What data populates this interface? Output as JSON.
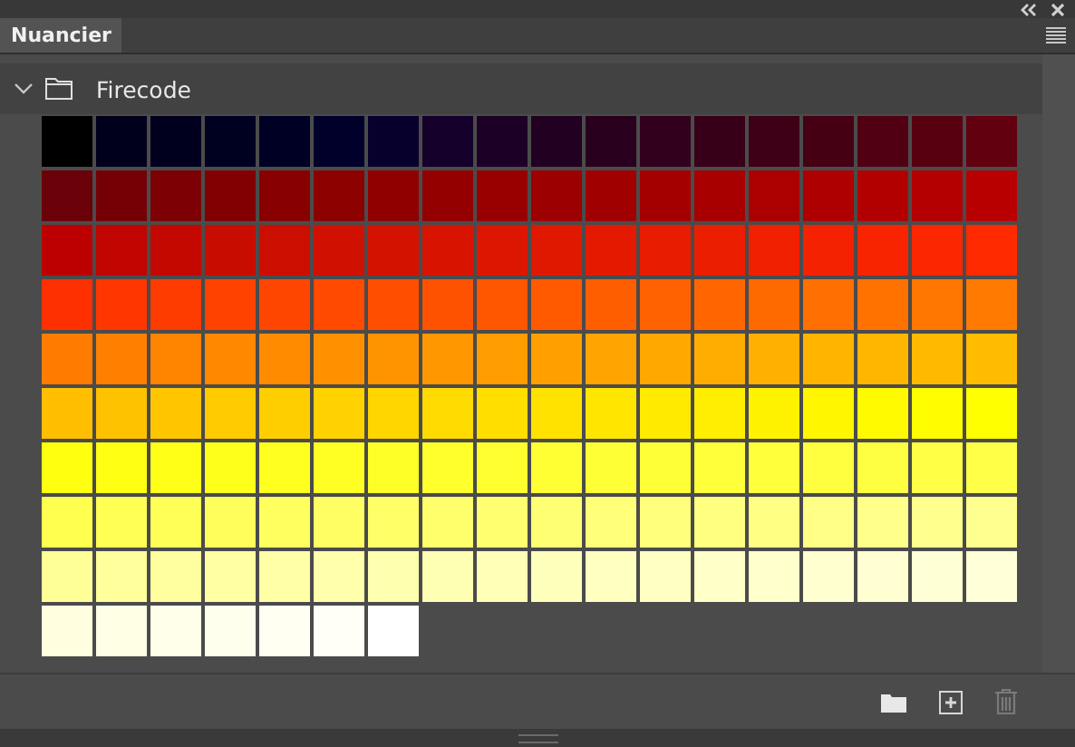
{
  "panel": {
    "tab": {
      "label": "Nuancier",
      "selected": true
    }
  },
  "groups": [
    {
      "name": "Firecode",
      "expanded": true,
      "swatches": [
        {
          "color": "#000000"
        },
        {
          "color": "#00001c"
        },
        {
          "color": "#00001e"
        },
        {
          "color": "#000020"
        },
        {
          "color": "#000024"
        },
        {
          "color": "#00002a"
        },
        {
          "color": "#08002c"
        },
        {
          "color": "#14002a"
        },
        {
          "color": "#1c0026"
        },
        {
          "color": "#220022"
        },
        {
          "color": "#28001e"
        },
        {
          "color": "#30001c"
        },
        {
          "color": "#380018"
        },
        {
          "color": "#3e0016"
        },
        {
          "color": "#460014"
        },
        {
          "color": "#500012"
        },
        {
          "color": "#580010"
        },
        {
          "color": "#620010"
        },
        {
          "color": "#6a0008"
        },
        {
          "color": "#740006"
        },
        {
          "color": "#7c0004"
        },
        {
          "color": "#820002"
        },
        {
          "color": "#880000"
        },
        {
          "color": "#8c0000"
        },
        {
          "color": "#900000"
        },
        {
          "color": "#940000"
        },
        {
          "color": "#980000"
        },
        {
          "color": "#9c0000"
        },
        {
          "color": "#a00000"
        },
        {
          "color": "#a40000"
        },
        {
          "color": "#a80000"
        },
        {
          "color": "#aa0000"
        },
        {
          "color": "#ae0000"
        },
        {
          "color": "#b20000"
        },
        {
          "color": "#b40000"
        },
        {
          "color": "#b80000"
        },
        {
          "color": "#bc0000"
        },
        {
          "color": "#c00400"
        },
        {
          "color": "#c40800"
        },
        {
          "color": "#c80c00"
        },
        {
          "color": "#cc0e00"
        },
        {
          "color": "#d01000"
        },
        {
          "color": "#d41200"
        },
        {
          "color": "#d81400"
        },
        {
          "color": "#dc1600"
        },
        {
          "color": "#e01800"
        },
        {
          "color": "#e41a00"
        },
        {
          "color": "#e81c00"
        },
        {
          "color": "#ec1e00"
        },
        {
          "color": "#f02000"
        },
        {
          "color": "#f42200"
        },
        {
          "color": "#f82400"
        },
        {
          "color": "#fc2600"
        },
        {
          "color": "#ff2a00"
        },
        {
          "color": "#ff3000"
        },
        {
          "color": "#ff3600"
        },
        {
          "color": "#ff3c00"
        },
        {
          "color": "#ff4200"
        },
        {
          "color": "#ff4600"
        },
        {
          "color": "#ff4a00"
        },
        {
          "color": "#ff4e00"
        },
        {
          "color": "#ff5200"
        },
        {
          "color": "#ff5600"
        },
        {
          "color": "#ff5a00"
        },
        {
          "color": "#ff5e00"
        },
        {
          "color": "#ff6200"
        },
        {
          "color": "#ff6600"
        },
        {
          "color": "#ff6a00"
        },
        {
          "color": "#ff6e00"
        },
        {
          "color": "#ff7200"
        },
        {
          "color": "#ff7600"
        },
        {
          "color": "#ff7a00"
        },
        {
          "color": "#ff7c00"
        },
        {
          "color": "#ff8000"
        },
        {
          "color": "#ff8400"
        },
        {
          "color": "#ff8800"
        },
        {
          "color": "#ff8c00"
        },
        {
          "color": "#ff9000"
        },
        {
          "color": "#ff9400"
        },
        {
          "color": "#ff9800"
        },
        {
          "color": "#ff9c00"
        },
        {
          "color": "#ffa000"
        },
        {
          "color": "#ffa400"
        },
        {
          "color": "#ffa800"
        },
        {
          "color": "#ffac00"
        },
        {
          "color": "#ffb000"
        },
        {
          "color": "#ffb400"
        },
        {
          "color": "#ffb600"
        },
        {
          "color": "#ffba00"
        },
        {
          "color": "#ffbc00"
        },
        {
          "color": "#ffbe00"
        },
        {
          "color": "#ffc200"
        },
        {
          "color": "#ffc600"
        },
        {
          "color": "#ffca00"
        },
        {
          "color": "#ffce00"
        },
        {
          "color": "#ffd200"
        },
        {
          "color": "#ffd600"
        },
        {
          "color": "#ffda00"
        },
        {
          "color": "#ffde00"
        },
        {
          "color": "#ffe200"
        },
        {
          "color": "#ffe600"
        },
        {
          "color": "#ffea00"
        },
        {
          "color": "#ffee00"
        },
        {
          "color": "#fff200"
        },
        {
          "color": "#fff600"
        },
        {
          "color": "#fffa00"
        },
        {
          "color": "#fffd00"
        },
        {
          "color": "#ffff00"
        },
        {
          "color": "#ffff10"
        },
        {
          "color": "#ffff14"
        },
        {
          "color": "#ffff18"
        },
        {
          "color": "#ffff1c"
        },
        {
          "color": "#ffff20"
        },
        {
          "color": "#ffff24"
        },
        {
          "color": "#ffff28"
        },
        {
          "color": "#ffff2c"
        },
        {
          "color": "#ffff30"
        },
        {
          "color": "#ffff34"
        },
        {
          "color": "#ffff36"
        },
        {
          "color": "#ffff38"
        },
        {
          "color": "#ffff3a"
        },
        {
          "color": "#ffff3c"
        },
        {
          "color": "#ffff40"
        },
        {
          "color": "#ffff42"
        },
        {
          "color": "#ffff46"
        },
        {
          "color": "#ffff48"
        },
        {
          "color": "#ffff50"
        },
        {
          "color": "#ffff54"
        },
        {
          "color": "#ffff58"
        },
        {
          "color": "#ffff5c"
        },
        {
          "color": "#ffff60"
        },
        {
          "color": "#ffff64"
        },
        {
          "color": "#ffff68"
        },
        {
          "color": "#ffff6c"
        },
        {
          "color": "#ffff70"
        },
        {
          "color": "#ffff74"
        },
        {
          "color": "#ffff78"
        },
        {
          "color": "#ffff7c"
        },
        {
          "color": "#ffff80"
        },
        {
          "color": "#ffff84"
        },
        {
          "color": "#ffff88"
        },
        {
          "color": "#ffff8a"
        },
        {
          "color": "#ffff8e"
        },
        {
          "color": "#ffff90"
        },
        {
          "color": "#ffff98"
        },
        {
          "color": "#ffff9c"
        },
        {
          "color": "#ffffa0"
        },
        {
          "color": "#ffffa4"
        },
        {
          "color": "#ffffa8"
        },
        {
          "color": "#ffffac"
        },
        {
          "color": "#ffffb0"
        },
        {
          "color": "#ffffb4"
        },
        {
          "color": "#ffffb8"
        },
        {
          "color": "#ffffbc"
        },
        {
          "color": "#ffffc0"
        },
        {
          "color": "#ffffc4"
        },
        {
          "color": "#ffffc8"
        },
        {
          "color": "#ffffcc"
        },
        {
          "color": "#ffffd0"
        },
        {
          "color": "#ffffd2"
        },
        {
          "color": "#ffffd6"
        },
        {
          "color": "#ffffd8"
        },
        {
          "color": "#ffffe0"
        },
        {
          "color": "#ffffe6"
        },
        {
          "color": "#ffffea"
        },
        {
          "color": "#ffffee"
        },
        {
          "color": "#fffff2"
        },
        {
          "color": "#fffff8"
        },
        {
          "color": "#ffffff"
        }
      ]
    }
  ]
}
